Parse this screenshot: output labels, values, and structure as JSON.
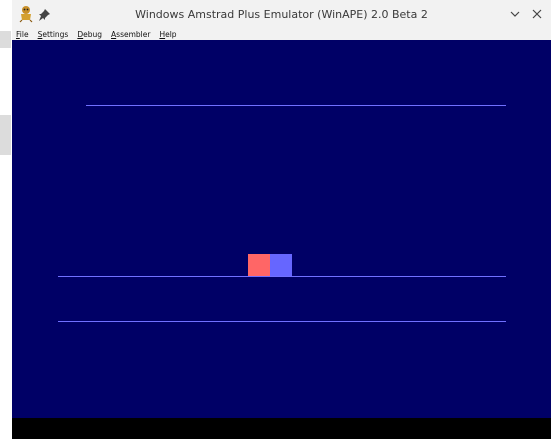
{
  "window": {
    "title": "Windows Amstrad Plus Emulator (WinAPE) 2.0 Beta 2"
  },
  "menu": {
    "items": [
      "File",
      "Settings",
      "Debug",
      "Assembler",
      "Help"
    ]
  },
  "colors": {
    "screen_background": "#000066",
    "line_color": "#7070ff",
    "red_block": "#ff6666",
    "blue_block": "#6666ff",
    "border": "#000000"
  }
}
